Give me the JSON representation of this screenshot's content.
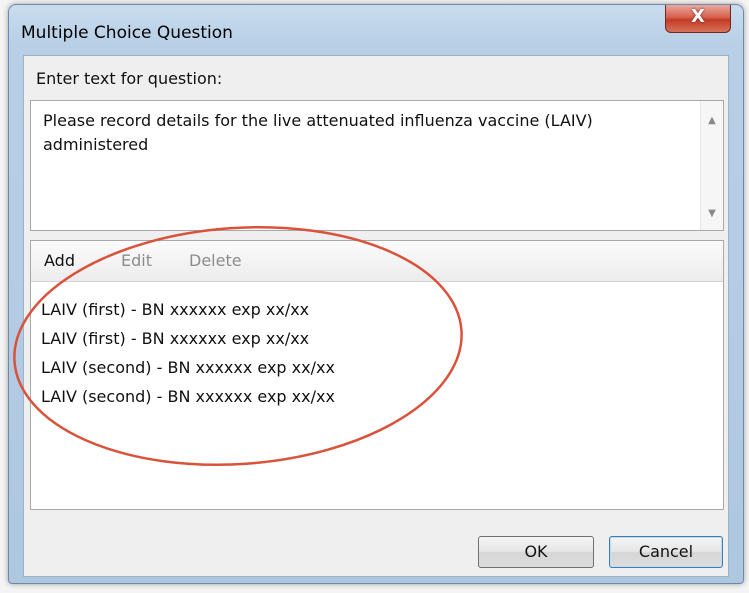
{
  "window": {
    "title": "Multiple Choice Question",
    "close_symbol": "X"
  },
  "question": {
    "label": "Enter text for question:",
    "text": "Please record details for the live attenuated influenza vaccine (LAIV)\nadministered"
  },
  "toolbar": {
    "add_label": "Add",
    "edit_label": "Edit",
    "delete_label": "Delete"
  },
  "choices": [
    "LAIV (first) - BN xxxxxx exp xx/xx",
    "LAIV (first) - BN xxxxxx exp xx/xx",
    "LAIV (second) - BN xxxxxx exp xx/xx",
    "LAIV (second) - BN xxxxxx exp xx/xx"
  ],
  "buttons": {
    "ok_label": "OK",
    "cancel_label": "Cancel"
  },
  "colors": {
    "annotation_circle": "#d9533a",
    "close_button": "#c23b25"
  },
  "icons": {
    "scroll_up": "scroll-up-arrow-icon",
    "scroll_down": "scroll-down-arrow-icon",
    "close": "close-icon"
  }
}
